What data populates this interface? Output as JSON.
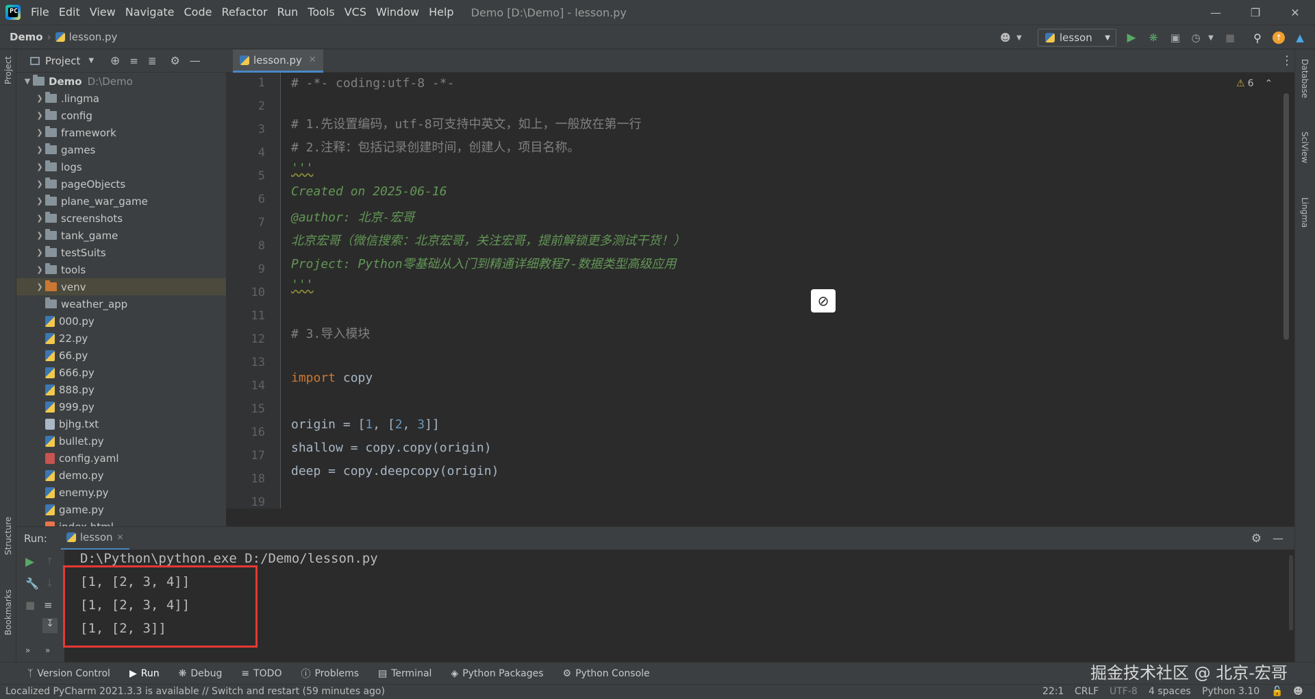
{
  "app": {
    "logo_letters": "PC",
    "menu": [
      "File",
      "Edit",
      "View",
      "Navigate",
      "Code",
      "Refactor",
      "Run",
      "Tools",
      "VCS",
      "Window",
      "Help"
    ],
    "window_title": "Demo [D:\\Demo] - lesson.py"
  },
  "navbar": {
    "project": "Demo",
    "file": "lesson.py",
    "run_config": "lesson"
  },
  "left_stripe": {
    "project": "Project",
    "structure": "Structure",
    "bookmarks": "Bookmarks"
  },
  "right_stripe": {
    "database": "Database",
    "sciview": "SciView",
    "lingma": "Lingma"
  },
  "project_panel": {
    "title": "Project",
    "root": {
      "name": "Demo",
      "path": "D:\\Demo"
    },
    "items": [
      {
        "label": ".lingma",
        "kind": "folder"
      },
      {
        "label": "config",
        "kind": "folder"
      },
      {
        "label": "framework",
        "kind": "folder"
      },
      {
        "label": "games",
        "kind": "folder"
      },
      {
        "label": "logs",
        "kind": "folder"
      },
      {
        "label": "pageObjects",
        "kind": "folder"
      },
      {
        "label": "plane_war_game",
        "kind": "folder"
      },
      {
        "label": "screenshots",
        "kind": "folder"
      },
      {
        "label": "tank_game",
        "kind": "folder"
      },
      {
        "label": "testSuits",
        "kind": "folder"
      },
      {
        "label": "tools",
        "kind": "folder"
      },
      {
        "label": "venv",
        "kind": "folder-excluded"
      },
      {
        "label": "weather_app",
        "kind": "folder-plain"
      },
      {
        "label": "000.py",
        "kind": "py"
      },
      {
        "label": "22.py",
        "kind": "py"
      },
      {
        "label": "66.py",
        "kind": "py"
      },
      {
        "label": "666.py",
        "kind": "py"
      },
      {
        "label": "888.py",
        "kind": "py"
      },
      {
        "label": "999.py",
        "kind": "py"
      },
      {
        "label": "bjhg.txt",
        "kind": "txt"
      },
      {
        "label": "bullet.py",
        "kind": "py"
      },
      {
        "label": "config.yaml",
        "kind": "yaml"
      },
      {
        "label": "demo.py",
        "kind": "py"
      },
      {
        "label": "enemy.py",
        "kind": "py"
      },
      {
        "label": "game.py",
        "kind": "py"
      },
      {
        "label": "index.html",
        "kind": "html"
      }
    ]
  },
  "editor": {
    "tab": "lesson.py",
    "warnings": "6",
    "line_numbers": [
      "1",
      "2",
      "3",
      "4",
      "5",
      "6",
      "7",
      "8",
      "9",
      "10",
      "11",
      "12",
      "13",
      "14",
      "15",
      "16",
      "17",
      "18",
      "19"
    ],
    "lines": {
      "l1": "# -*- coding:utf-8 -*-",
      "l3": "# 1.先设置编码，utf-8可支持中英文，如上，一般放在第一行",
      "l5": "# 2.注释：包括记录创建时间，创建人，项目名称。",
      "l6": "'''",
      "l7": "Created on 2025-06-16",
      "l8": "@author: 北京-宏哥",
      "l9": "北京宏哥（微信搜索：北京宏哥，关注宏哥，提前解锁更多测试干货！）",
      "l10": "Project: Python零基础从入门到精通详细教程7-数据类型高级应用",
      "l11": "'''",
      "l13": "# 3.导入模块",
      "l15_kw": "import",
      "l15_rest": " copy",
      "l17_a": "origin = [",
      "l17_n1": "1",
      "l17_b": ", [",
      "l17_n2": "2",
      "l17_c": ", ",
      "l17_n3": "3",
      "l17_d": "]]",
      "l18": "shallow = copy.copy(origin)",
      "l19": "deep = copy.deepcopy(origin)"
    }
  },
  "run_panel": {
    "label": "Run:",
    "tab": "lesson",
    "output": [
      "D:\\Python\\python.exe D:/Demo/lesson.py",
      "[1, [2, 3, 4]]",
      "[1, [2, 3, 4]]",
      "[1, [2, 3]]"
    ]
  },
  "bottom_tabs": [
    "Version Control",
    "Run",
    "Debug",
    "TODO",
    "Problems",
    "Terminal",
    "Python Packages",
    "Python Console"
  ],
  "watermark": "掘金技术社区 @ 北京-宏哥",
  "status": {
    "message": "Localized PyCharm 2021.3.3 is available // Switch and restart (59 minutes ago)",
    "position": "22:1",
    "line_sep": "CRLF",
    "encoding": "UTF-8",
    "indent": "4 spaces",
    "interpreter": "Python 3.10"
  }
}
